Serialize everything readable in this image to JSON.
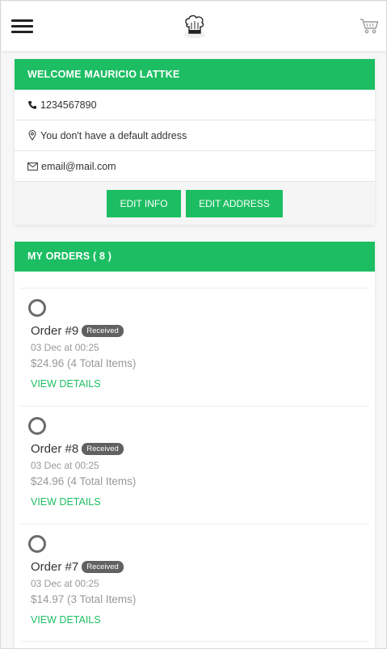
{
  "header": {
    "menu_icon": "hamburger-menu-icon",
    "logo_icon": "chef-hat-logo",
    "cart_icon": "shopping-cart-icon"
  },
  "profile": {
    "title": "WELCOME MAURICIO LATTKE",
    "phone_icon": "phone-icon",
    "phone": "1234567890",
    "address_icon": "location-pin-icon",
    "address": "You don't have a default address",
    "email_icon": "envelope-icon",
    "email": "email@mail.com",
    "edit_info_label": "EDIT INFO",
    "edit_address_label": "EDIT ADDRESS"
  },
  "orders": {
    "title": "MY ORDERS ( 8 )",
    "items": [
      {
        "title": "Order #9",
        "status": "Received",
        "date": "03 Dec at 00:25",
        "price": "$24.96 (4 Total Items)",
        "link": "VIEW DETAILS"
      },
      {
        "title": "Order #8",
        "status": "Received",
        "date": "03 Dec at 00:25",
        "price": "$24.96 (4 Total Items)",
        "link": "VIEW DETAILS"
      },
      {
        "title": "Order #7",
        "status": "Received",
        "date": "03 Dec at 00:25",
        "price": "$14.97 (3 Total Items)",
        "link": "VIEW DETAILS"
      }
    ]
  },
  "colors": {
    "accent": "#1dbe63",
    "badge": "#616161",
    "muted_text": "#999999"
  }
}
